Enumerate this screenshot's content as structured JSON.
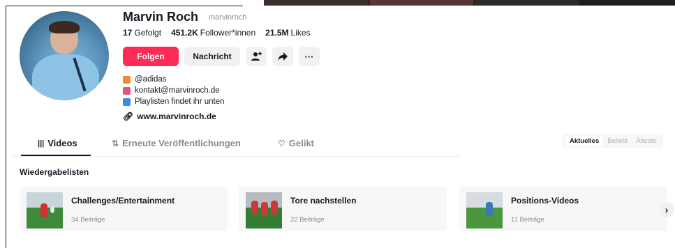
{
  "profile": {
    "name": "Marvin Roch",
    "handle": "marvinroch",
    "stats": [
      {
        "value": "17",
        "label": "Gefolgt"
      },
      {
        "value": "451.2K",
        "label": "Follower*innen"
      },
      {
        "value": "21.5M",
        "label": "Likes"
      }
    ],
    "follow_label": "Folgen",
    "message_label": "Nachricht",
    "icon_buttons": [
      {
        "name": "add-friend-icon",
        "glyph": "👤"
      },
      {
        "name": "share-icon",
        "glyph": "➦"
      },
      {
        "name": "more-icon",
        "glyph": "···"
      }
    ],
    "bio": [
      {
        "icon": "adidas-icon",
        "color": "#f08a24",
        "text": "@adidas"
      },
      {
        "icon": "mail-icon",
        "color": "#e0567a",
        "text": "kontakt@marvinroch.de"
      },
      {
        "icon": "info-icon",
        "color": "#3b8fe0",
        "text": "Playlisten findet ihr unten"
      }
    ],
    "website": "www.marvinroch.de"
  },
  "tabs": [
    {
      "glyph": "|||",
      "label": "Videos"
    },
    {
      "glyph": "⇅",
      "label": "Erneute Veröffentlichungen"
    },
    {
      "glyph": "♡",
      "label": "Gelikt"
    }
  ],
  "sort": {
    "options": [
      "Aktuelles",
      "Beliebt",
      "Älteste"
    ],
    "selected": "Aktuelles"
  },
  "playlists": {
    "title": "Wiedergabelisten",
    "items": [
      {
        "title": "Challenges/Entertainment",
        "count": "34 Beiträge"
      },
      {
        "title": "Tore nachstellen",
        "count": "22 Beiträge"
      },
      {
        "title": "Positions-Videos",
        "count": "11 Beiträge"
      }
    ],
    "next_glyph": "›"
  },
  "colors": {
    "accent": "#fe2c55",
    "text": "#161823",
    "muted": "#8a8b91"
  }
}
